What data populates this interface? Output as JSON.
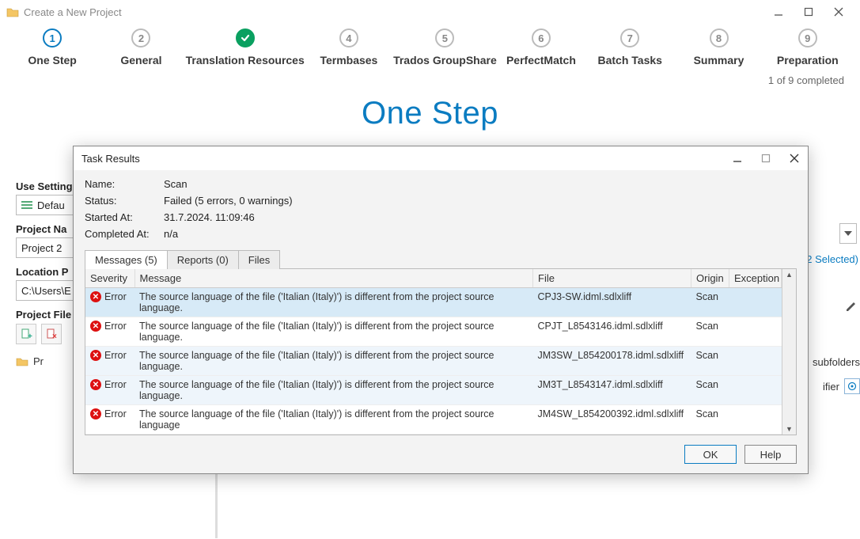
{
  "window": {
    "title": "Create a New Project"
  },
  "steps": [
    {
      "num": "1",
      "label": "One Step",
      "state": "active"
    },
    {
      "num": "2",
      "label": "General",
      "state": ""
    },
    {
      "num": "✓",
      "label": "Translation Resources",
      "state": "done"
    },
    {
      "num": "4",
      "label": "Termbases",
      "state": ""
    },
    {
      "num": "5",
      "label": "Trados GroupShare",
      "state": ""
    },
    {
      "num": "6",
      "label": "PerfectMatch",
      "state": ""
    },
    {
      "num": "7",
      "label": "Batch Tasks",
      "state": ""
    },
    {
      "num": "8",
      "label": "Summary",
      "state": ""
    },
    {
      "num": "9",
      "label": "Preparation",
      "state": ""
    }
  ],
  "progress_text": "1 of 9 completed",
  "heading": "One Step",
  "form": {
    "use_settings_label": "Use Settings",
    "use_settings_value": "Defau",
    "project_name_label": "Project Na",
    "project_name_value": "Project 2",
    "location_label": "Location P",
    "location_value": "C:\\Users\\E",
    "project_files_label": "Project File",
    "tree_item": "Pr"
  },
  "right_links": {
    "selected": "2 Selected)",
    "subfolders": "subfolders",
    "ifier": "ifier"
  },
  "dialog": {
    "title": "Task Results",
    "name_label": "Name:",
    "name_value": "Scan",
    "status_label": "Status:",
    "status_value": "Failed (5 errors, 0 warnings)",
    "started_label": "Started At:",
    "started_value": "31.7.2024. 11:09:46",
    "completed_label": "Completed At:",
    "completed_value": "n/a",
    "tabs": {
      "messages": "Messages (5)",
      "reports": "Reports (0)",
      "files": "Files"
    },
    "columns": {
      "severity": "Severity",
      "message": "Message",
      "file": "File",
      "origin": "Origin",
      "exception": "Exception"
    },
    "rows": [
      {
        "severity": "Error",
        "message": "The source language of the file ('Italian (Italy)') is different from the project source language.",
        "file": "CPJ3-SW.idml.sdlxliff",
        "origin": "Scan",
        "exception": "",
        "sel": true
      },
      {
        "severity": "Error",
        "message": "The source language of the file ('Italian (Italy)') is different from the project source language.",
        "file": "CPJT_L8543146.idml.sdlxliff",
        "origin": "Scan",
        "exception": "",
        "sel": false
      },
      {
        "severity": "Error",
        "message": "The source language of the file ('Italian (Italy)') is different from the project source language.",
        "file": "JM3SW_L854200178.idml.sdlxliff",
        "origin": "Scan",
        "exception": "",
        "sel": false,
        "alt": true
      },
      {
        "severity": "Error",
        "message": "The source language of the file ('Italian (Italy)') is different from the project source language.",
        "file": "JM3T_L8543147.idml.sdlxliff",
        "origin": "Scan",
        "exception": "",
        "sel": false,
        "alt": true
      },
      {
        "severity": "Error",
        "message": "The source language of the file ('Italian (Italy)') is different from the project source language",
        "file": "JM4SW_L854200392.idml.sdlxliff",
        "origin": "Scan",
        "exception": "",
        "sel": false,
        "cut": true
      }
    ],
    "buttons": {
      "ok": "OK",
      "help": "Help"
    }
  }
}
